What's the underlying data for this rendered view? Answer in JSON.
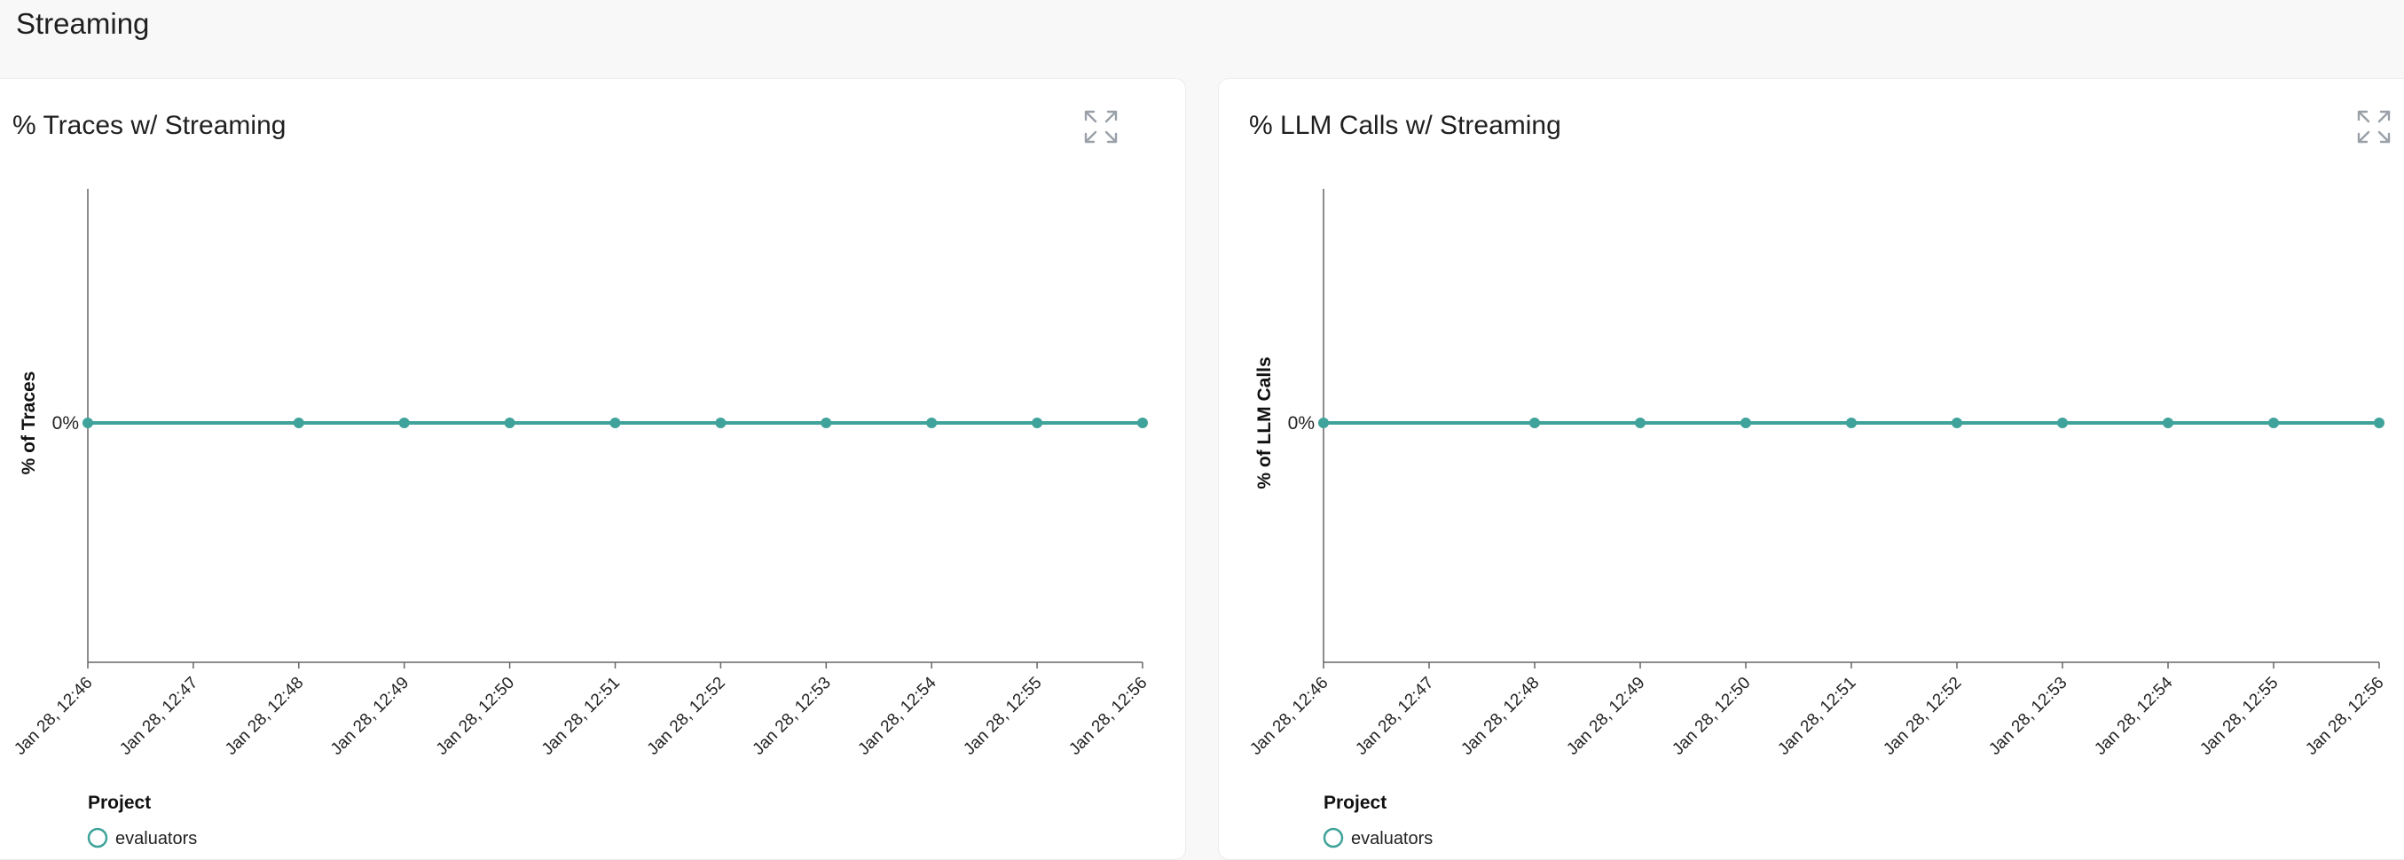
{
  "section": {
    "title": "Streaming"
  },
  "icons": {
    "expand": "expand-icon"
  },
  "colors": {
    "series": "#3fa39b",
    "axis": "#666666"
  },
  "panels": [
    {
      "title": "% Traces w/ Streaming",
      "legend": {
        "title": "Project",
        "items": [
          "evaluators"
        ]
      }
    },
    {
      "title": "% LLM Calls w/ Streaming",
      "legend": {
        "title": "Project",
        "items": [
          "evaluators"
        ]
      }
    }
  ],
  "chart_data": [
    {
      "type": "line",
      "title": "% Traces w/ Streaming",
      "xlabel": "",
      "ylabel": "% of Traces",
      "x_ticks": [
        "Jan 28, 12:46",
        "Jan 28, 12:47",
        "Jan 28, 12:48",
        "Jan 28, 12:49",
        "Jan 28, 12:50",
        "Jan 28, 12:51",
        "Jan 28, 12:52",
        "Jan 28, 12:53",
        "Jan 28, 12:54",
        "Jan 28, 12:55",
        "Jan 28, 12:56"
      ],
      "y_ticks": [
        "0%"
      ],
      "legend_position": "bottom-left",
      "grid": false,
      "series": [
        {
          "name": "evaluators",
          "x": [
            "Jan 28, 12:46",
            "Jan 28, 12:48",
            "Jan 28, 12:49",
            "Jan 28, 12:50",
            "Jan 28, 12:51",
            "Jan 28, 12:52",
            "Jan 28, 12:53",
            "Jan 28, 12:54",
            "Jan 28, 12:55",
            "Jan 28, 12:56"
          ],
          "values": [
            0,
            0,
            0,
            0,
            0,
            0,
            0,
            0,
            0,
            0
          ]
        }
      ]
    },
    {
      "type": "line",
      "title": "% LLM Calls w/ Streaming",
      "xlabel": "",
      "ylabel": "% of LLM Calls",
      "x_ticks": [
        "Jan 28, 12:46",
        "Jan 28, 12:47",
        "Jan 28, 12:48",
        "Jan 28, 12:49",
        "Jan 28, 12:50",
        "Jan 28, 12:51",
        "Jan 28, 12:52",
        "Jan 28, 12:53",
        "Jan 28, 12:54",
        "Jan 28, 12:55",
        "Jan 28, 12:56"
      ],
      "y_ticks": [
        "0%"
      ],
      "legend_position": "bottom-left",
      "grid": false,
      "series": [
        {
          "name": "evaluators",
          "x": [
            "Jan 28, 12:46",
            "Jan 28, 12:48",
            "Jan 28, 12:49",
            "Jan 28, 12:50",
            "Jan 28, 12:51",
            "Jan 28, 12:52",
            "Jan 28, 12:53",
            "Jan 28, 12:54",
            "Jan 28, 12:55",
            "Jan 28, 12:56"
          ],
          "values": [
            0,
            0,
            0,
            0,
            0,
            0,
            0,
            0,
            0,
            0
          ]
        }
      ]
    }
  ]
}
